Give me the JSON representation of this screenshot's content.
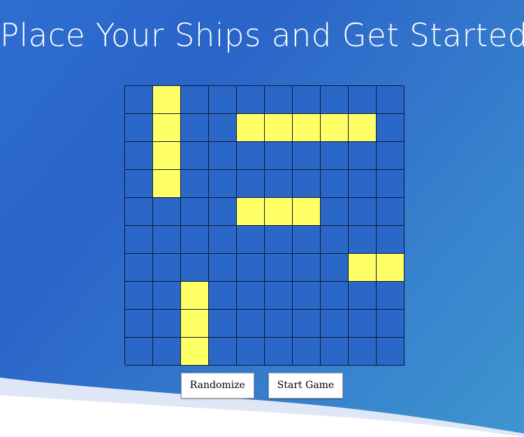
{
  "title": "Place Your Ships and Get Started!",
  "board": {
    "rows": 10,
    "cols": 10,
    "grid": [
      [
        0,
        1,
        0,
        0,
        0,
        0,
        0,
        0,
        0,
        0
      ],
      [
        0,
        1,
        0,
        0,
        1,
        1,
        1,
        1,
        1,
        0
      ],
      [
        0,
        1,
        0,
        0,
        0,
        0,
        0,
        0,
        0,
        0
      ],
      [
        0,
        1,
        0,
        0,
        0,
        0,
        0,
        0,
        0,
        0
      ],
      [
        0,
        0,
        0,
        0,
        1,
        1,
        1,
        0,
        0,
        0
      ],
      [
        0,
        0,
        0,
        0,
        0,
        0,
        0,
        0,
        0,
        0
      ],
      [
        0,
        0,
        0,
        0,
        0,
        0,
        0,
        0,
        1,
        1
      ],
      [
        0,
        0,
        1,
        0,
        0,
        0,
        0,
        0,
        0,
        0
      ],
      [
        0,
        0,
        1,
        0,
        0,
        0,
        0,
        0,
        0,
        0
      ],
      [
        0,
        0,
        1,
        0,
        0,
        0,
        0,
        0,
        0,
        0
      ]
    ]
  },
  "buttons": {
    "randomize": "Randomize",
    "start": "Start Game"
  },
  "colors": {
    "water": "#2a67c6",
    "ship": "#ffff66",
    "grid_line": "#0d1a3a"
  }
}
